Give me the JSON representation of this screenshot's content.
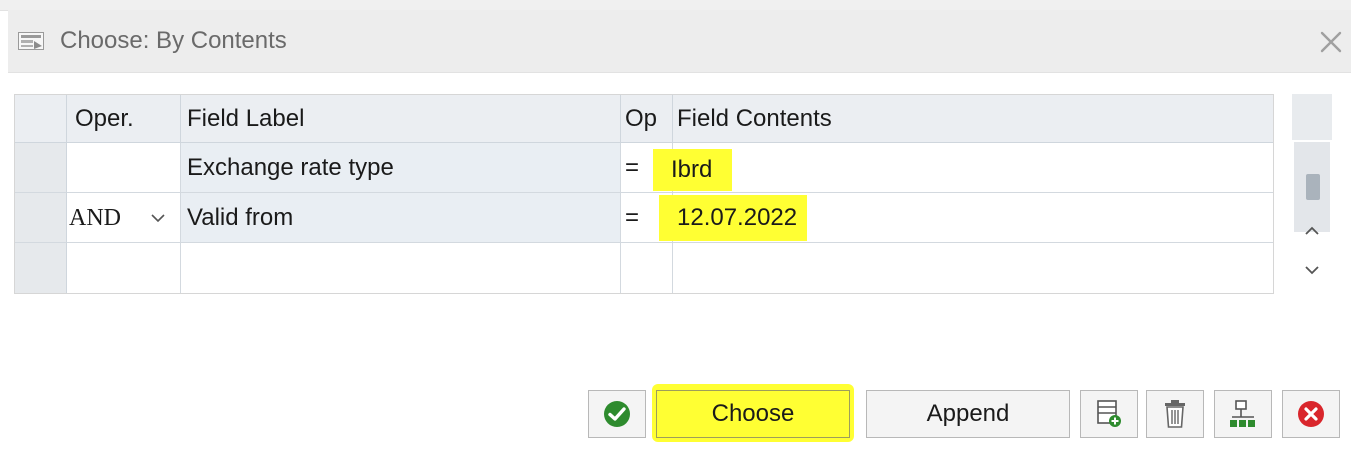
{
  "dialog": {
    "title": "Choose: By Contents"
  },
  "table": {
    "headers": {
      "oper": "Oper.",
      "field_label": "Field Label",
      "op": "Op",
      "field_contents": "Field Contents"
    },
    "rows": [
      {
        "oper": "",
        "field_label": "Exchange rate type",
        "op": "=",
        "field_contents": "Ibrd"
      },
      {
        "oper": "AND",
        "field_label": "Valid from",
        "op": "=",
        "field_contents": "12.07.2022"
      },
      {
        "oper": "",
        "field_label": "",
        "op": "",
        "field_contents": ""
      }
    ]
  },
  "toolbar": {
    "choose_label": "Choose",
    "append_label": "Append"
  },
  "colors": {
    "highlight": "#ffff33",
    "confirm_green": "#2e8b2e",
    "cancel_red": "#d9262c"
  },
  "icons": {
    "title": "dialog-icon",
    "close": "close-icon",
    "confirm": "check-circle-icon",
    "insert_row": "insert-row-icon",
    "delete": "trash-icon",
    "expand": "tree-structure-icon",
    "cancel": "cancel-circle-icon"
  }
}
